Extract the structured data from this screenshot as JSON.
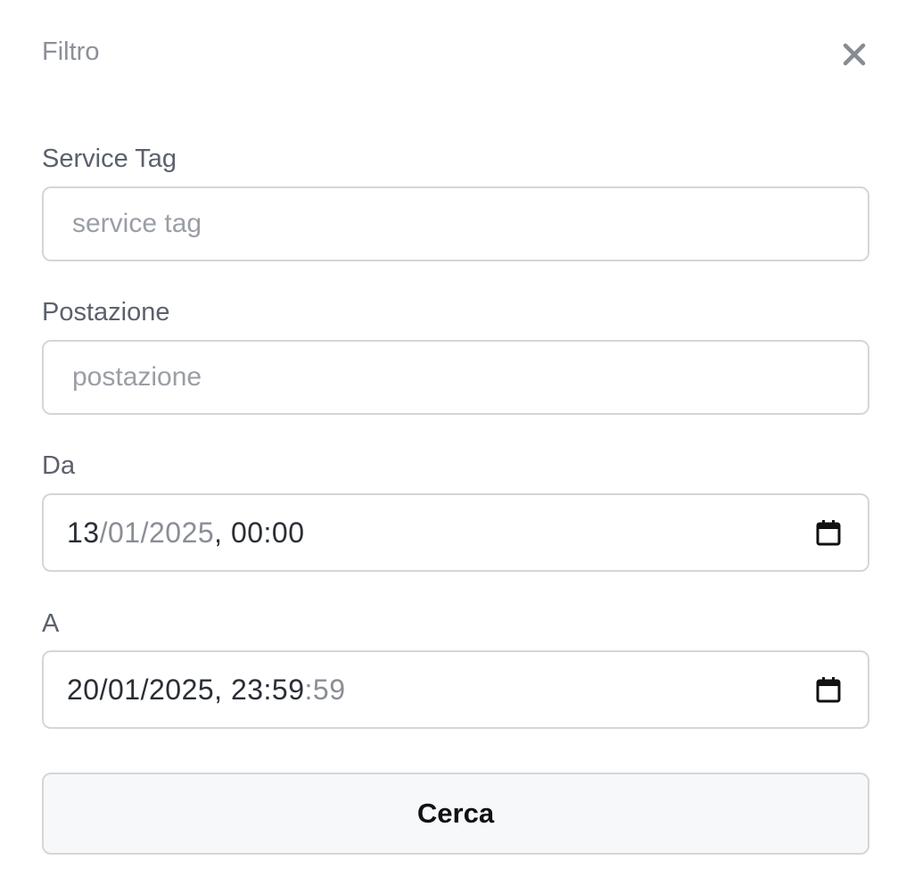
{
  "panel": {
    "title": "Filtro",
    "close_icon": "close-icon"
  },
  "fields": {
    "service_tag": {
      "label": "Service Tag",
      "value": "",
      "placeholder": "service tag"
    },
    "postazione": {
      "label": "Postazione",
      "value": "",
      "placeholder": "postazione"
    },
    "da": {
      "label": "Da",
      "day": "13",
      "sep1": "/",
      "month": "01",
      "sep2": "/",
      "year": "2025",
      "sep3": ", ",
      "hour": "00",
      "sep4": ":",
      "minute": "00",
      "icon": "calendar-icon"
    },
    "a": {
      "label": "A",
      "day": "20",
      "sep1": "/",
      "month": "01",
      "sep2": "/",
      "year": "2025",
      "sep3": ", ",
      "hour": "23",
      "sep4": ":",
      "minute": "59",
      "sep5": ":",
      "second": "59",
      "icon": "calendar-icon"
    }
  },
  "actions": {
    "search_label": "Cerca"
  },
  "colors": {
    "border": "#d4d6da",
    "label": "#5b616c",
    "title": "#8b9099",
    "placeholder": "#9a9ea6",
    "button_bg": "#f7f8f9"
  }
}
